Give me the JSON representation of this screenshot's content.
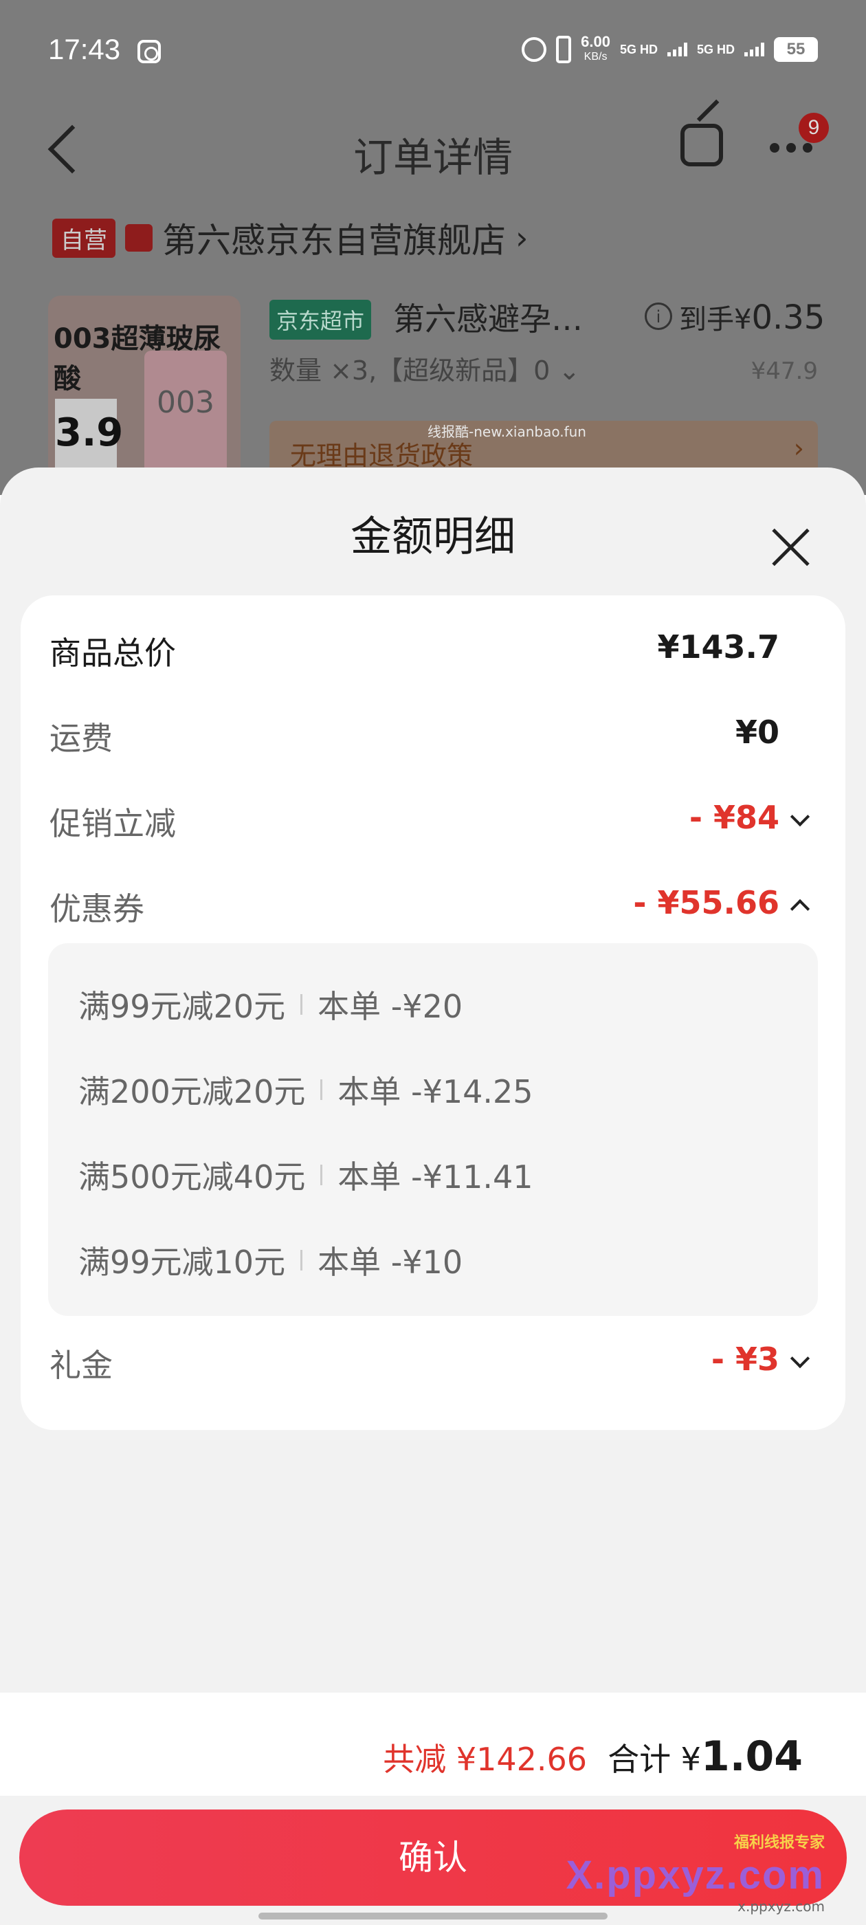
{
  "status_bar": {
    "time": "17:43",
    "net_speed": "6.00",
    "net_unit": "KB/s",
    "network_1": "5G HD",
    "network_2": "5G HD",
    "battery": "55"
  },
  "nav": {
    "title": "订单详情",
    "more_badge": "9"
  },
  "shop": {
    "tag": "自营",
    "name": "第六感京东自营旗舰店",
    "arrow": "›"
  },
  "product": {
    "image_title": "003超薄玻尿酸",
    "image_price": "3.9",
    "image_box_text": "003",
    "channel_tag": "京东超市",
    "name": "第六感避孕…",
    "hand_price_prefix": "到手¥",
    "hand_price": "0.35",
    "quantity_line": "数量 ×3,【超级新品】0 ⌄",
    "original_price": "¥47.9",
    "policy": "无理由退货政策",
    "policy_arrow": "›",
    "watermark": "线报酷-new.xianbao.fun"
  },
  "sheet": {
    "title": "金额明细",
    "rows": [
      {
        "label": "商品总价",
        "value": "¥143.7"
      },
      {
        "label": "运费",
        "value": "¥0"
      },
      {
        "label": "促销立减",
        "value": "- ¥84"
      },
      {
        "label": "优惠券",
        "value": "- ¥55.66"
      },
      {
        "label": "礼金",
        "value": "- ¥3"
      }
    ],
    "coupons": [
      {
        "condition": "满99元减20元",
        "amount": "本单 -¥20"
      },
      {
        "condition": "满200元减20元",
        "amount": "本单 -¥14.25"
      },
      {
        "condition": "满500元减40元",
        "amount": "本单 -¥11.41"
      },
      {
        "condition": "满99元减10元",
        "amount": "本单 -¥10"
      }
    ]
  },
  "footer": {
    "total_save": "共减 ¥142.66",
    "total_label": "合计 ¥",
    "total_value": "1.04",
    "confirm": "确认",
    "brand_small": "福利线报专家",
    "brand_big": "X.ppxyz.com",
    "brand_url": "x.ppxyz.com"
  },
  "colors": {
    "accent_red": "#e0342c",
    "button_red": "#f0343e"
  }
}
